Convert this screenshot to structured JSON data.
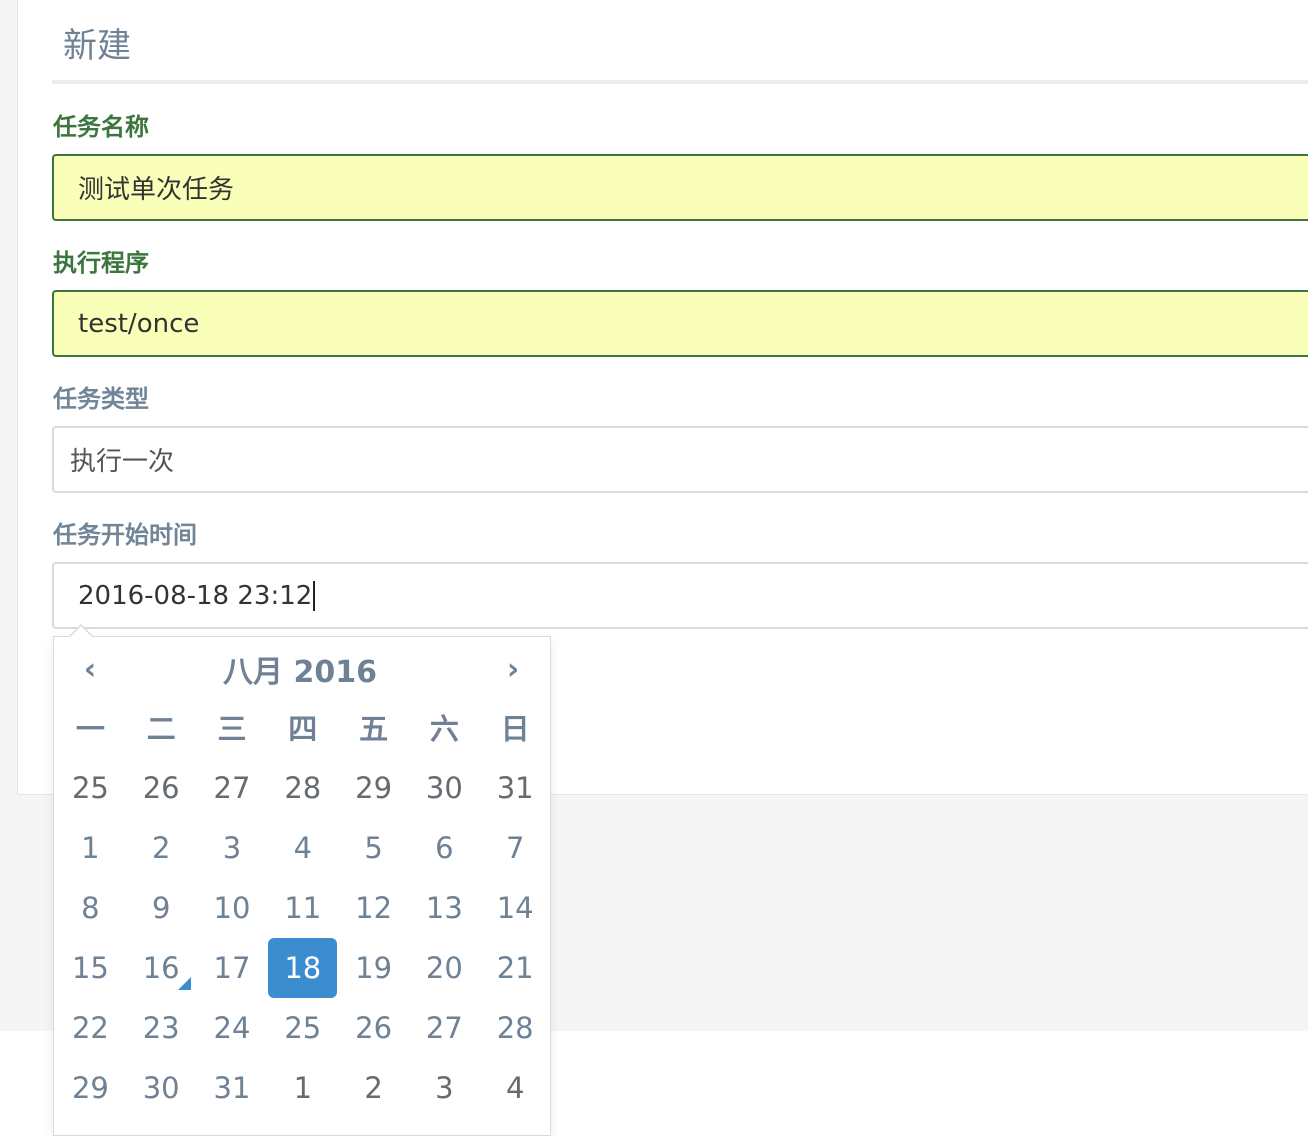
{
  "page": {
    "title": "新建"
  },
  "form": {
    "task_name": {
      "label": "任务名称",
      "value": "测试单次任务"
    },
    "program": {
      "label": "执行程序",
      "value": "test/once"
    },
    "task_type": {
      "label": "任务类型",
      "value": "执行一次"
    },
    "start_time": {
      "label": "任务开始时间",
      "value": "2016-08-18 23:12"
    }
  },
  "datepicker": {
    "title": "八月 2016",
    "prev_label": "‹",
    "next_label": "›",
    "weekdays": [
      "一",
      "二",
      "三",
      "四",
      "五",
      "六",
      "日"
    ],
    "weeks": [
      [
        "25",
        "26",
        "27",
        "28",
        "29",
        "30",
        "31"
      ],
      [
        "1",
        "2",
        "3",
        "4",
        "5",
        "6",
        "7"
      ],
      [
        "8",
        "9",
        "10",
        "11",
        "12",
        "13",
        "14"
      ],
      [
        "15",
        "16",
        "17",
        "18",
        "19",
        "20",
        "21"
      ],
      [
        "22",
        "23",
        "24",
        "25",
        "26",
        "27",
        "28"
      ],
      [
        "29",
        "30",
        "31",
        "1",
        "2",
        "3",
        "4"
      ]
    ],
    "other_month": [
      [
        true,
        true,
        true,
        true,
        true,
        true,
        true
      ],
      [
        false,
        false,
        false,
        false,
        false,
        false,
        false
      ],
      [
        false,
        false,
        false,
        false,
        false,
        false,
        false
      ],
      [
        false,
        false,
        false,
        false,
        false,
        false,
        false
      ],
      [
        false,
        false,
        false,
        false,
        false,
        false,
        false
      ],
      [
        false,
        false,
        false,
        true,
        true,
        true,
        true
      ]
    ],
    "selected_day": "18",
    "today_day": "16",
    "accent_color": "#3c8dd0"
  },
  "colors": {
    "success": "#3c763d",
    "success_bg": "#f9ffb9",
    "muted": "#708598"
  }
}
